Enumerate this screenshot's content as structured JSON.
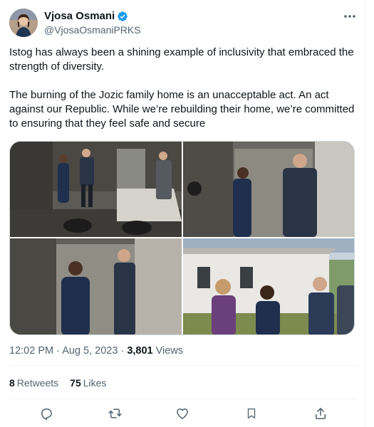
{
  "author": {
    "display_name": "Vjosa Osmani",
    "handle": "@VjosaOsmaniPRKS",
    "verified": true,
    "avatar_icon": "profile-photo"
  },
  "tweet": {
    "paragraph_1": "Istog has always been a shining example of inclusivity that embraced the strength of diversity.",
    "paragraph_2": "The burning of the Jozic family home is an unacceptable act. An act against our Republic. While we’re rebuilding their home, we’re committed to ensuring that they feel safe and secure"
  },
  "media": {
    "photo_count": 4,
    "photo_icons": [
      "burned-room-photo",
      "burned-room-photo",
      "burned-room-photo",
      "house-exterior-photo"
    ]
  },
  "meta": {
    "time": "12:02 PM",
    "separator": "·",
    "date": "Aug 5, 2023",
    "views_count": "3,801",
    "views_label": "Views"
  },
  "stats": {
    "retweets_count": "8",
    "retweets_label": "Retweets",
    "likes_count": "75",
    "likes_label": "Likes"
  },
  "actions": [
    "reply-icon",
    "retweet-icon",
    "like-icon",
    "bookmark-icon",
    "share-icon"
  ],
  "colors": {
    "text_primary": "#0f1419",
    "text_secondary": "#536471",
    "verified_blue": "#1d9bf0",
    "divider": "#eff3f4"
  }
}
